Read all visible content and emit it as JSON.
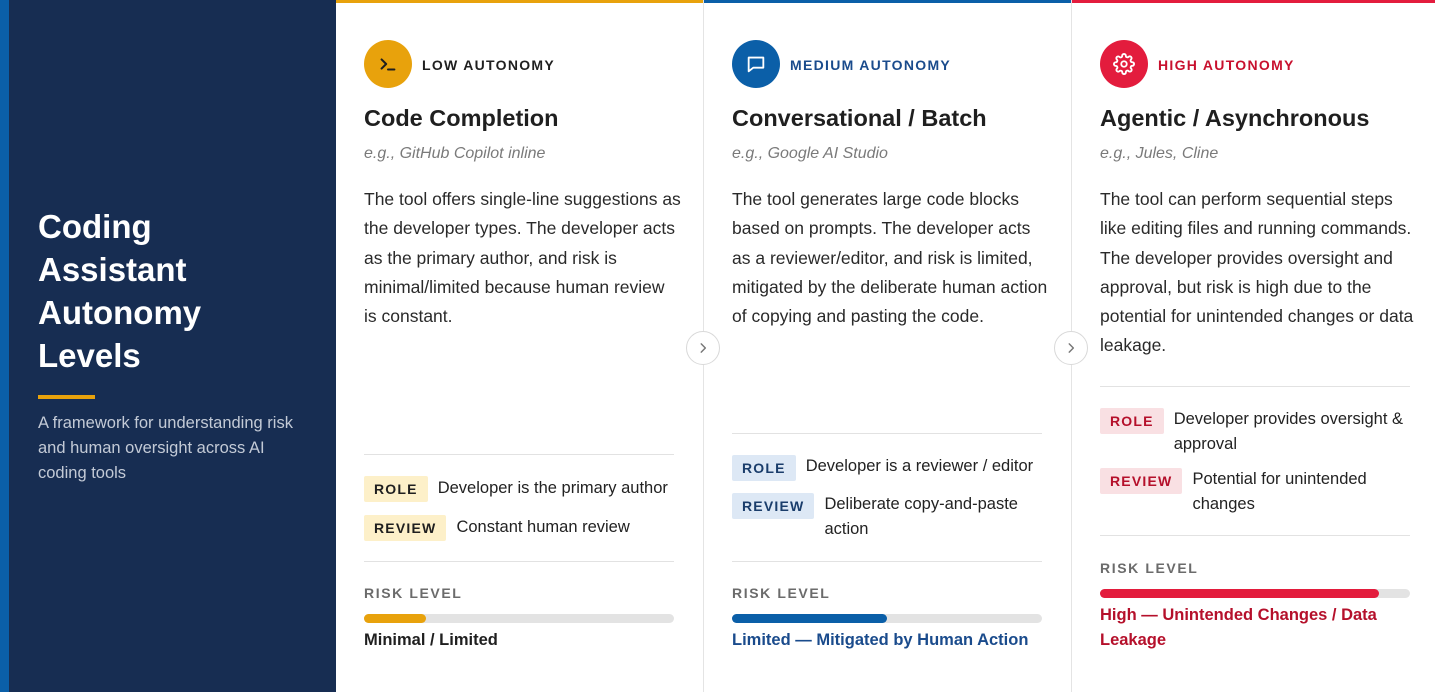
{
  "sidebar": {
    "title": "Coding Assistant Autonomy Levels",
    "subtitle": "A framework for understanding risk and human oversight across AI coding tools"
  },
  "colors": {
    "sidebar_bg": "#172d52",
    "sidebar_edge": "#0b5fa8",
    "accent_gold": "#e8a20c"
  },
  "cards": [
    {
      "level": "LOW AUTONOMY",
      "icon": "terminal-icon",
      "name": "Code Completion",
      "example": "e.g., GitHub Copilot inline",
      "description": "The tool offers single-line suggestions as the developer types. The developer acts as the primary author, and risk is minimal/limited because human review is constant.",
      "role_tag": "ROLE",
      "role": "Developer is the primary author",
      "review_tag": "REVIEW",
      "review": "Constant human review",
      "risk_label": "RISK LEVEL",
      "risk_value": "Minimal / Limited",
      "risk_fraction": 0.2,
      "accent": "#e8a20c",
      "level_color": "#1f1f1f",
      "risk_text_color": "#1f1f1f",
      "tag_bg": "#fdf0c9",
      "tag_color": "#1f1f1f"
    },
    {
      "level": "MEDIUM AUTONOMY",
      "icon": "chat-bubble-icon",
      "name": "Conversational / Batch",
      "example": "e.g., Google AI Studio",
      "description": "The tool generates large code blocks based on prompts. The developer acts as a reviewer/editor, and risk is limited, mitigated by the deliberate human action of copying and pasting the code.",
      "role_tag": "ROLE",
      "role": "Developer is a reviewer / editor",
      "review_tag": "REVIEW",
      "review": "Deliberate copy-and-paste action",
      "risk_label": "RISK LEVEL",
      "risk_value": "Limited — Mitigated by Human Action",
      "risk_fraction": 0.5,
      "accent": "#0b5fa8",
      "level_color": "#1a4b8c",
      "risk_text_color": "#1a4b8c",
      "tag_bg": "#dde8f5",
      "tag_color": "#1a3d6b"
    },
    {
      "level": "HIGH AUTONOMY",
      "icon": "gear-icon",
      "name": "Agentic / Asynchronous",
      "example": "e.g., Jules, Cline",
      "description": "The tool can perform sequential steps like editing files and running commands. The developer provides oversight and approval, but risk is high due to the potential for unintended changes or data leakage.",
      "role_tag": "ROLE",
      "role": "Developer provides oversight & approval",
      "review_tag": "REVIEW",
      "review": "Potential for unintended changes",
      "risk_label": "RISK LEVEL",
      "risk_value": "High — Unintended Changes / Data Leakage",
      "risk_fraction": 0.9,
      "accent": "#e31c3d",
      "level_color": "#c8102e",
      "risk_text_color": "#b5102b",
      "tag_bg": "#f9e0e3",
      "tag_color": "#b5102b"
    }
  ]
}
